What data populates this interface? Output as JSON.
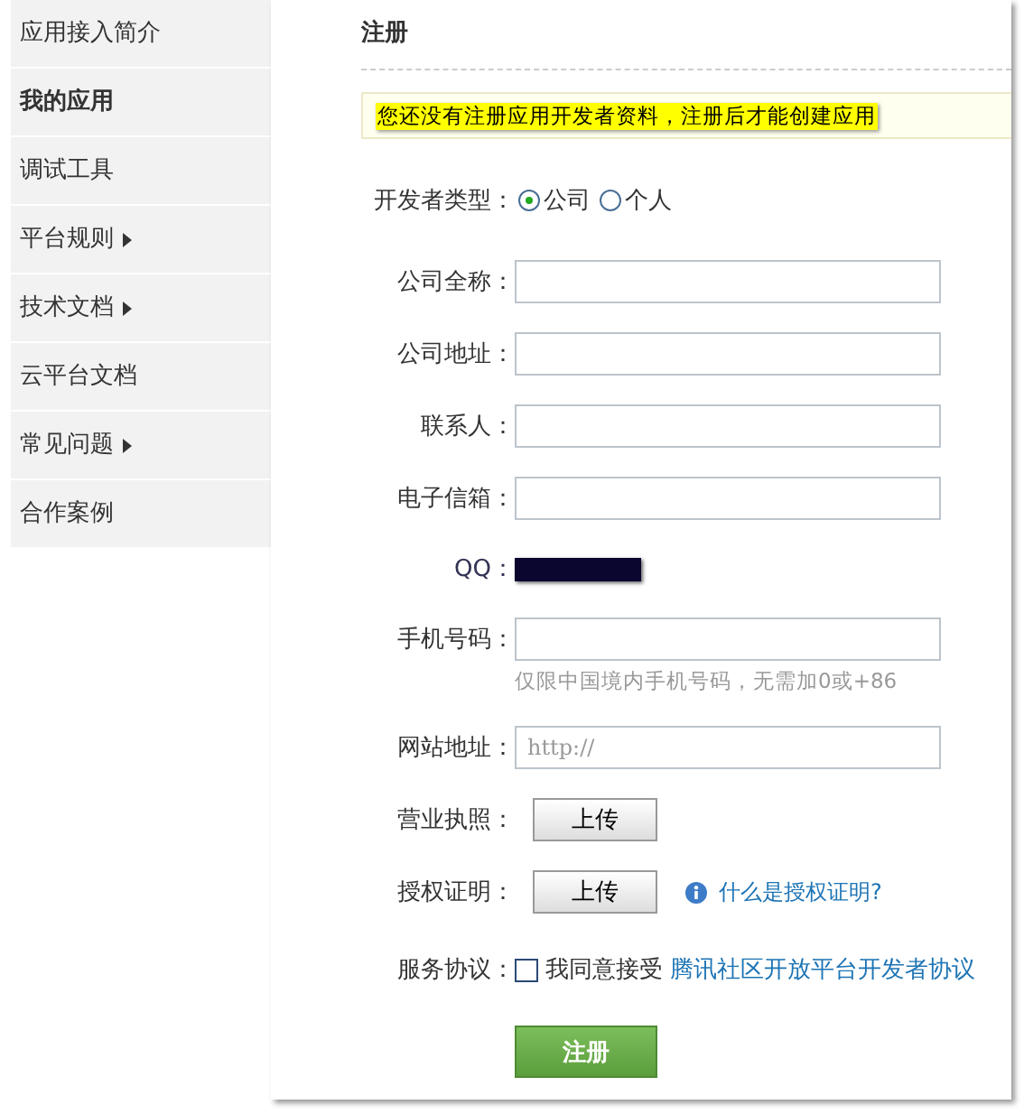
{
  "sidebar": {
    "items": [
      {
        "label": "应用接入简介",
        "selected": false,
        "has_submenu": false
      },
      {
        "label": "我的应用",
        "selected": true,
        "has_submenu": false
      },
      {
        "label": "调试工具",
        "selected": false,
        "has_submenu": false
      },
      {
        "label": "平台规则",
        "selected": false,
        "has_submenu": true
      },
      {
        "label": "技术文档",
        "selected": false,
        "has_submenu": true
      },
      {
        "label": "云平台文档",
        "selected": false,
        "has_submenu": false
      },
      {
        "label": "常见问题",
        "selected": false,
        "has_submenu": true
      },
      {
        "label": "合作案例",
        "selected": false,
        "has_submenu": false
      }
    ]
  },
  "title": "注册",
  "notice": "您还没有注册应用开发者资料，注册后才能创建应用",
  "form": [
    {
      "kind": "radio",
      "label": "开发者类型：",
      "options": [
        {
          "label": "公司",
          "selected": true
        },
        {
          "label": "个人",
          "selected": false
        }
      ]
    },
    {
      "kind": "text",
      "label": "公司全称："
    },
    {
      "kind": "text",
      "label": "公司地址："
    },
    {
      "kind": "text",
      "label": "联系人："
    },
    {
      "kind": "text",
      "label": "电子信箱："
    },
    {
      "kind": "redacted",
      "label": "QQ："
    },
    {
      "kind": "text",
      "label": "手机号码：",
      "hint": "仅限中国境内手机号码，无需加0或+86"
    },
    {
      "kind": "text",
      "label": "网站地址：",
      "placeholder": "http://"
    },
    {
      "kind": "upload",
      "label": "营业执照：",
      "button": "上传"
    },
    {
      "kind": "upload",
      "label": "授权证明：",
      "button": "上传",
      "help_link": "什么是授权证明?"
    },
    {
      "kind": "checkbox",
      "label": "服务协议：",
      "checked": false,
      "text": "我同意接受",
      "link": "腾讯社区开放平台开发者协议"
    }
  ],
  "submit": "注册"
}
